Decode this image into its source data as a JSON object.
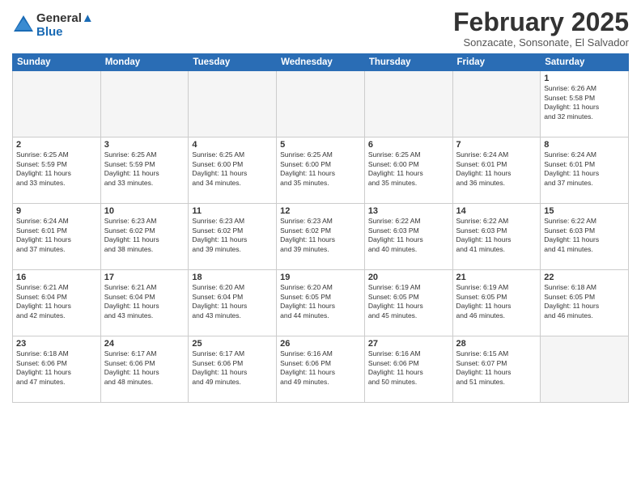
{
  "header": {
    "logo_line1": "General",
    "logo_line2": "Blue",
    "month_year": "February 2025",
    "location": "Sonzacate, Sonsonate, El Salvador"
  },
  "calendar": {
    "days_of_week": [
      "Sunday",
      "Monday",
      "Tuesday",
      "Wednesday",
      "Thursday",
      "Friday",
      "Saturday"
    ],
    "weeks": [
      [
        {
          "day": "",
          "info": ""
        },
        {
          "day": "",
          "info": ""
        },
        {
          "day": "",
          "info": ""
        },
        {
          "day": "",
          "info": ""
        },
        {
          "day": "",
          "info": ""
        },
        {
          "day": "",
          "info": ""
        },
        {
          "day": "1",
          "info": "Sunrise: 6:26 AM\nSunset: 5:58 PM\nDaylight: 11 hours\nand 32 minutes."
        }
      ],
      [
        {
          "day": "2",
          "info": "Sunrise: 6:25 AM\nSunset: 5:59 PM\nDaylight: 11 hours\nand 33 minutes."
        },
        {
          "day": "3",
          "info": "Sunrise: 6:25 AM\nSunset: 5:59 PM\nDaylight: 11 hours\nand 33 minutes."
        },
        {
          "day": "4",
          "info": "Sunrise: 6:25 AM\nSunset: 6:00 PM\nDaylight: 11 hours\nand 34 minutes."
        },
        {
          "day": "5",
          "info": "Sunrise: 6:25 AM\nSunset: 6:00 PM\nDaylight: 11 hours\nand 35 minutes."
        },
        {
          "day": "6",
          "info": "Sunrise: 6:25 AM\nSunset: 6:00 PM\nDaylight: 11 hours\nand 35 minutes."
        },
        {
          "day": "7",
          "info": "Sunrise: 6:24 AM\nSunset: 6:01 PM\nDaylight: 11 hours\nand 36 minutes."
        },
        {
          "day": "8",
          "info": "Sunrise: 6:24 AM\nSunset: 6:01 PM\nDaylight: 11 hours\nand 37 minutes."
        }
      ],
      [
        {
          "day": "9",
          "info": "Sunrise: 6:24 AM\nSunset: 6:01 PM\nDaylight: 11 hours\nand 37 minutes."
        },
        {
          "day": "10",
          "info": "Sunrise: 6:23 AM\nSunset: 6:02 PM\nDaylight: 11 hours\nand 38 minutes."
        },
        {
          "day": "11",
          "info": "Sunrise: 6:23 AM\nSunset: 6:02 PM\nDaylight: 11 hours\nand 39 minutes."
        },
        {
          "day": "12",
          "info": "Sunrise: 6:23 AM\nSunset: 6:02 PM\nDaylight: 11 hours\nand 39 minutes."
        },
        {
          "day": "13",
          "info": "Sunrise: 6:22 AM\nSunset: 6:03 PM\nDaylight: 11 hours\nand 40 minutes."
        },
        {
          "day": "14",
          "info": "Sunrise: 6:22 AM\nSunset: 6:03 PM\nDaylight: 11 hours\nand 41 minutes."
        },
        {
          "day": "15",
          "info": "Sunrise: 6:22 AM\nSunset: 6:03 PM\nDaylight: 11 hours\nand 41 minutes."
        }
      ],
      [
        {
          "day": "16",
          "info": "Sunrise: 6:21 AM\nSunset: 6:04 PM\nDaylight: 11 hours\nand 42 minutes."
        },
        {
          "day": "17",
          "info": "Sunrise: 6:21 AM\nSunset: 6:04 PM\nDaylight: 11 hours\nand 43 minutes."
        },
        {
          "day": "18",
          "info": "Sunrise: 6:20 AM\nSunset: 6:04 PM\nDaylight: 11 hours\nand 43 minutes."
        },
        {
          "day": "19",
          "info": "Sunrise: 6:20 AM\nSunset: 6:05 PM\nDaylight: 11 hours\nand 44 minutes."
        },
        {
          "day": "20",
          "info": "Sunrise: 6:19 AM\nSunset: 6:05 PM\nDaylight: 11 hours\nand 45 minutes."
        },
        {
          "day": "21",
          "info": "Sunrise: 6:19 AM\nSunset: 6:05 PM\nDaylight: 11 hours\nand 46 minutes."
        },
        {
          "day": "22",
          "info": "Sunrise: 6:18 AM\nSunset: 6:05 PM\nDaylight: 11 hours\nand 46 minutes."
        }
      ],
      [
        {
          "day": "23",
          "info": "Sunrise: 6:18 AM\nSunset: 6:06 PM\nDaylight: 11 hours\nand 47 minutes."
        },
        {
          "day": "24",
          "info": "Sunrise: 6:17 AM\nSunset: 6:06 PM\nDaylight: 11 hours\nand 48 minutes."
        },
        {
          "day": "25",
          "info": "Sunrise: 6:17 AM\nSunset: 6:06 PM\nDaylight: 11 hours\nand 49 minutes."
        },
        {
          "day": "26",
          "info": "Sunrise: 6:16 AM\nSunset: 6:06 PM\nDaylight: 11 hours\nand 49 minutes."
        },
        {
          "day": "27",
          "info": "Sunrise: 6:16 AM\nSunset: 6:06 PM\nDaylight: 11 hours\nand 50 minutes."
        },
        {
          "day": "28",
          "info": "Sunrise: 6:15 AM\nSunset: 6:07 PM\nDaylight: 11 hours\nand 51 minutes."
        },
        {
          "day": "",
          "info": ""
        }
      ]
    ]
  }
}
